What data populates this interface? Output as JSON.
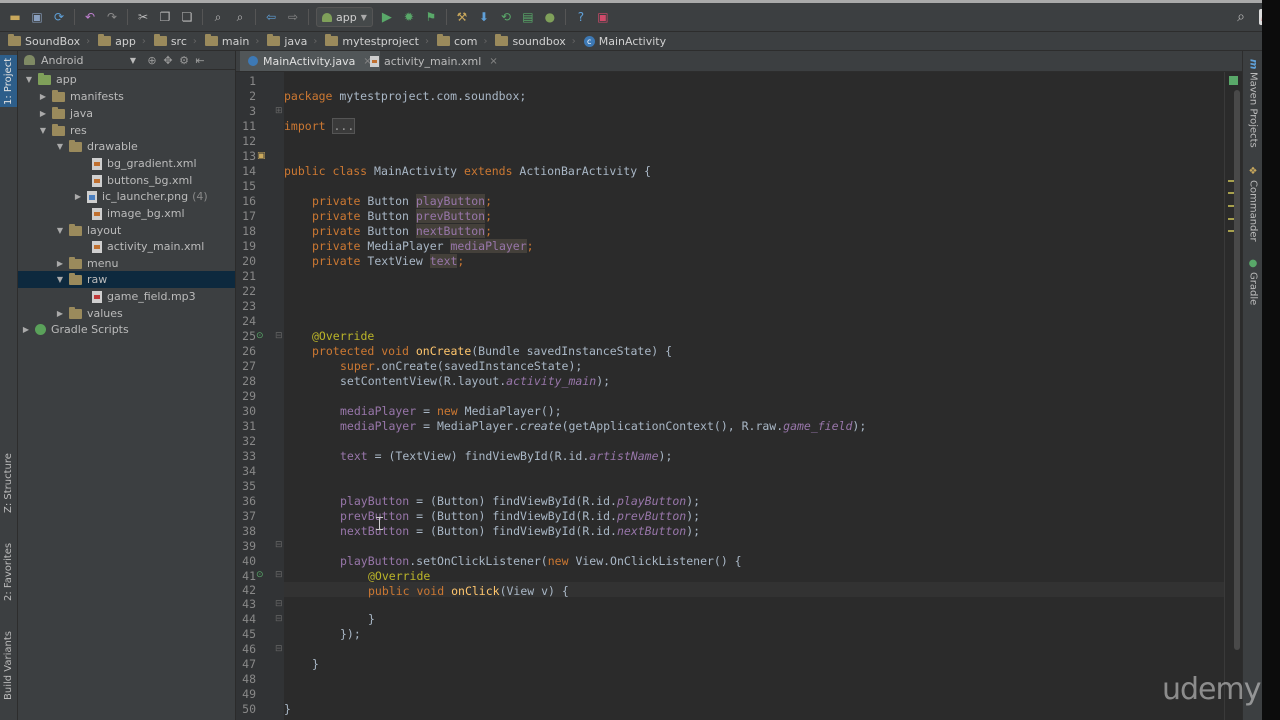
{
  "toolbar": {
    "run_config": "app"
  },
  "breadcrumb": [
    "SoundBox",
    "app",
    "src",
    "main",
    "java",
    "mytestproject",
    "com",
    "soundbox",
    "MainActivity"
  ],
  "left_tabs": {
    "project": "1: Project",
    "structure": "Z: Structure",
    "favorites": "2: Favorites",
    "build_variants": "Build Variants"
  },
  "right_tabs": {
    "maven": "Maven Projects",
    "commander": "Commander",
    "gradle": "Gradle"
  },
  "project_panel": {
    "view": "Android",
    "tree": [
      {
        "label": "app",
        "count": ""
      },
      {
        "label": "manifests",
        "count": ""
      },
      {
        "label": "java",
        "count": ""
      },
      {
        "label": "res",
        "count": ""
      },
      {
        "label": "drawable",
        "count": ""
      },
      {
        "label": "bg_gradient.xml",
        "count": ""
      },
      {
        "label": "buttons_bg.xml",
        "count": ""
      },
      {
        "label": "ic_launcher.png",
        "count": "(4)"
      },
      {
        "label": "image_bg.xml",
        "count": ""
      },
      {
        "label": "layout",
        "count": ""
      },
      {
        "label": "activity_main.xml",
        "count": ""
      },
      {
        "label": "menu",
        "count": ""
      },
      {
        "label": "raw",
        "count": ""
      },
      {
        "label": "game_field.mp3",
        "count": ""
      },
      {
        "label": "values",
        "count": ""
      },
      {
        "label": "Gradle Scripts",
        "count": ""
      }
    ]
  },
  "editor": {
    "tabs": [
      {
        "label": "MainActivity.java",
        "active": true
      },
      {
        "label": "activity_main.xml",
        "active": false
      }
    ],
    "line_numbers": [
      "1",
      "2",
      "3",
      "11",
      "12",
      "13",
      "14",
      "15",
      "16",
      "17",
      "18",
      "19",
      "20",
      "21",
      "22",
      "23",
      "24",
      "25",
      "26",
      "27",
      "28",
      "29",
      "30",
      "31",
      "32",
      "33",
      "34",
      "35",
      "36",
      "37",
      "38",
      "39",
      "40",
      "41",
      "42",
      "43",
      "44",
      "45",
      "46",
      "47",
      "48",
      "49",
      "50"
    ],
    "code": {
      "l1": {
        "a": "package",
        "b": " mytestproject.com.soundbox;"
      },
      "l3": {
        "a": "import",
        "b": "..."
      },
      "l13": {
        "a": "public class",
        "b": " MainActivity ",
        "c": "extends",
        "d": " ActionBarActivity {"
      },
      "l15": {
        "a": "private",
        "b": " Button ",
        "c": "playButton",
        "d": ";"
      },
      "l16": {
        "a": "private",
        "b": " Button ",
        "c": "prevButton",
        "d": ";"
      },
      "l17": {
        "a": "private",
        "b": " Button ",
        "c": "nextButton",
        "d": ";"
      },
      "l18": {
        "a": "private",
        "b": " MediaPlayer ",
        "c": "mediaPlayer",
        "d": ";"
      },
      "l19": {
        "a": "private",
        "b": " TextView ",
        "c": "text",
        "d": ";"
      },
      "l24": {
        "a": "@Override"
      },
      "l25": {
        "a": "protected void",
        "b": " onCreate",
        "c": "(Bundle savedInstanceState) {"
      },
      "l26": {
        "a": "super",
        "b": ".onCreate(savedInstanceState);"
      },
      "l27": {
        "a": "setContentView(R.layout.",
        "b": "activity_main",
        "c": ");"
      },
      "l29": {
        "a": "mediaPlayer",
        "b": " = ",
        "c": "new",
        "d": " MediaPlayer();"
      },
      "l30": {
        "a": "mediaPlayer",
        "b": " = MediaPlayer.",
        "c": "create",
        "d": "(getApplicationContext(), R.raw.",
        "e": "game_field",
        "f": ");"
      },
      "l32": {
        "a": "text",
        "b": " = (TextView) findViewById(R.id.",
        "c": "artistName",
        "d": ");"
      },
      "l35": {
        "a": "playButton",
        "b": " = (Button) findViewById(R.id.",
        "c": "playButton",
        "d": ");"
      },
      "l36": {
        "a": "prevButton",
        "b": " = (Button) findViewById(R.id.",
        "c": "prevButton",
        "d": ");"
      },
      "l37": {
        "a": "nextButton",
        "b": " = (Button) findViewById(R.id.",
        "c": "nextButton",
        "d": ");"
      },
      "l39": {
        "a": "playButton",
        "b": ".setOnClickListener(",
        "c": "new",
        "d": " View.OnClickListener() {"
      },
      "l40": {
        "a": "@Override"
      },
      "l41": {
        "a": "public void",
        "b": " onClick",
        "c": "(View v) {"
      },
      "l43": {
        "a": "}"
      },
      "l44": {
        "a": "});"
      },
      "l46": {
        "a": "}"
      },
      "l49": {
        "a": "}"
      }
    }
  },
  "watermark": "udemy"
}
